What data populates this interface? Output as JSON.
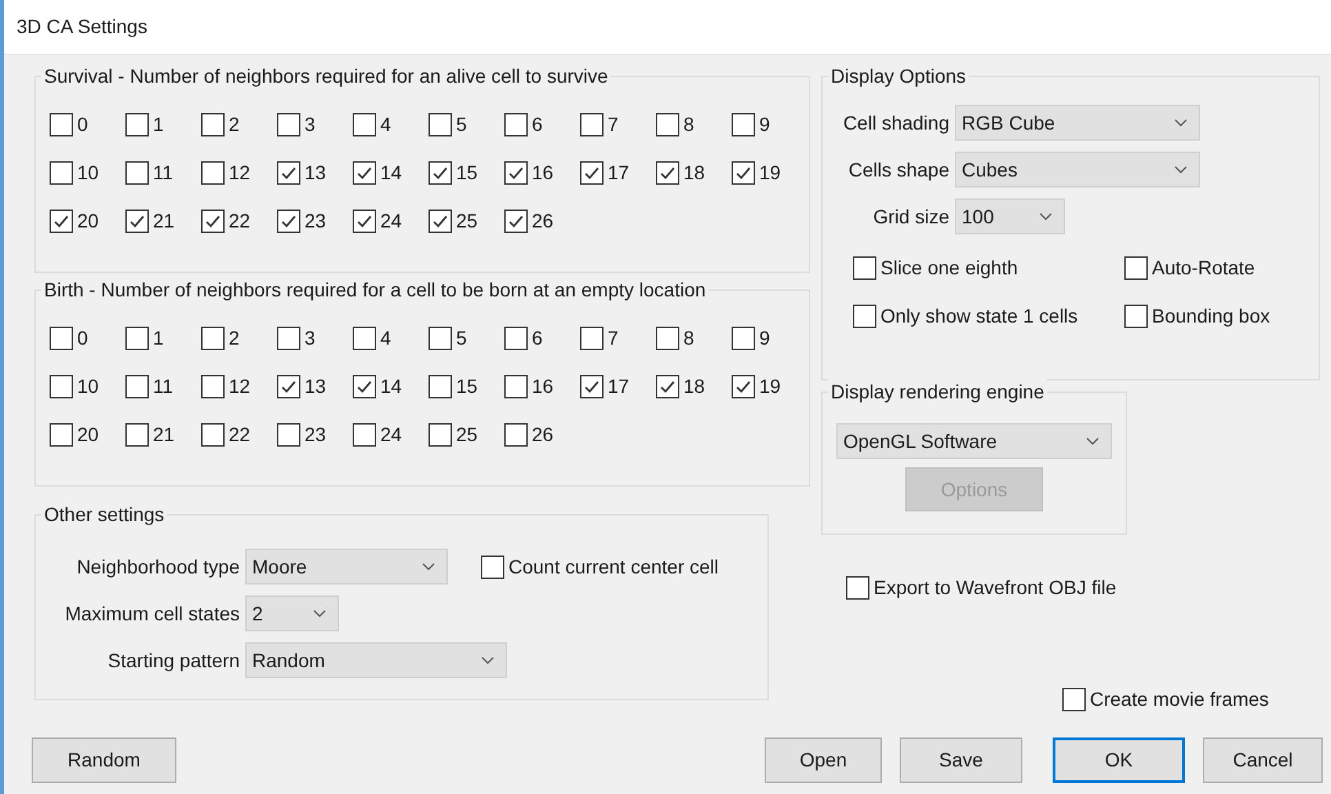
{
  "window": {
    "title": "3D CA Settings"
  },
  "survival": {
    "title": "Survival - Number of neighbors required for an alive cell to survive",
    "options": [
      {
        "label": "0",
        "checked": false
      },
      {
        "label": "1",
        "checked": false
      },
      {
        "label": "2",
        "checked": false
      },
      {
        "label": "3",
        "checked": false
      },
      {
        "label": "4",
        "checked": false
      },
      {
        "label": "5",
        "checked": false
      },
      {
        "label": "6",
        "checked": false
      },
      {
        "label": "7",
        "checked": false
      },
      {
        "label": "8",
        "checked": false
      },
      {
        "label": "9",
        "checked": false
      },
      {
        "label": "10",
        "checked": false
      },
      {
        "label": "11",
        "checked": false
      },
      {
        "label": "12",
        "checked": false
      },
      {
        "label": "13",
        "checked": true
      },
      {
        "label": "14",
        "checked": true
      },
      {
        "label": "15",
        "checked": true
      },
      {
        "label": "16",
        "checked": true
      },
      {
        "label": "17",
        "checked": true
      },
      {
        "label": "18",
        "checked": true
      },
      {
        "label": "19",
        "checked": true
      },
      {
        "label": "20",
        "checked": true
      },
      {
        "label": "21",
        "checked": true
      },
      {
        "label": "22",
        "checked": true
      },
      {
        "label": "23",
        "checked": true
      },
      {
        "label": "24",
        "checked": true
      },
      {
        "label": "25",
        "checked": true
      },
      {
        "label": "26",
        "checked": true
      }
    ]
  },
  "birth": {
    "title": "Birth - Number of neighbors required for a cell to be born at an empty location",
    "options": [
      {
        "label": "0",
        "checked": false
      },
      {
        "label": "1",
        "checked": false
      },
      {
        "label": "2",
        "checked": false
      },
      {
        "label": "3",
        "checked": false
      },
      {
        "label": "4",
        "checked": false
      },
      {
        "label": "5",
        "checked": false
      },
      {
        "label": "6",
        "checked": false
      },
      {
        "label": "7",
        "checked": false
      },
      {
        "label": "8",
        "checked": false
      },
      {
        "label": "9",
        "checked": false
      },
      {
        "label": "10",
        "checked": false
      },
      {
        "label": "11",
        "checked": false
      },
      {
        "label": "12",
        "checked": false
      },
      {
        "label": "13",
        "checked": true
      },
      {
        "label": "14",
        "checked": true
      },
      {
        "label": "15",
        "checked": false
      },
      {
        "label": "16",
        "checked": false
      },
      {
        "label": "17",
        "checked": true
      },
      {
        "label": "18",
        "checked": true
      },
      {
        "label": "19",
        "checked": true
      },
      {
        "label": "20",
        "checked": false
      },
      {
        "label": "21",
        "checked": false
      },
      {
        "label": "22",
        "checked": false
      },
      {
        "label": "23",
        "checked": false
      },
      {
        "label": "24",
        "checked": false
      },
      {
        "label": "25",
        "checked": false
      },
      {
        "label": "26",
        "checked": false
      }
    ]
  },
  "other_settings": {
    "title": "Other settings",
    "neighborhood_type": {
      "label": "Neighborhood type",
      "value": "Moore"
    },
    "count_center": {
      "label": "Count current center cell",
      "checked": false
    },
    "max_states": {
      "label": "Maximum cell states",
      "value": "2"
    },
    "starting_pattern": {
      "label": "Starting pattern",
      "value": "Random"
    }
  },
  "display_options": {
    "title": "Display Options",
    "cell_shading": {
      "label": "Cell shading",
      "value": "RGB Cube"
    },
    "cells_shape": {
      "label": "Cells shape",
      "value": "Cubes"
    },
    "grid_size": {
      "label": "Grid size",
      "value": "100"
    },
    "checkboxes": [
      {
        "label": "Slice one eighth",
        "checked": false
      },
      {
        "label": "Auto-Rotate",
        "checked": false
      },
      {
        "label": "Only show state 1 cells",
        "checked": false
      },
      {
        "label": "Bounding box",
        "checked": false
      }
    ]
  },
  "rendering": {
    "title": "Display rendering engine",
    "value": "OpenGL Software",
    "button": {
      "label": "Options",
      "disabled": true
    }
  },
  "export_obj": {
    "label": "Export to Wavefront OBJ file",
    "checked": false
  },
  "movie_frames": {
    "label": "Create movie frames",
    "checked": false
  },
  "buttons": [
    {
      "label": "Random",
      "default": false
    },
    {
      "label": "Open",
      "default": false
    },
    {
      "label": "Save",
      "default": false
    },
    {
      "label": "OK",
      "default": true
    },
    {
      "label": "Cancel",
      "default": false
    }
  ]
}
